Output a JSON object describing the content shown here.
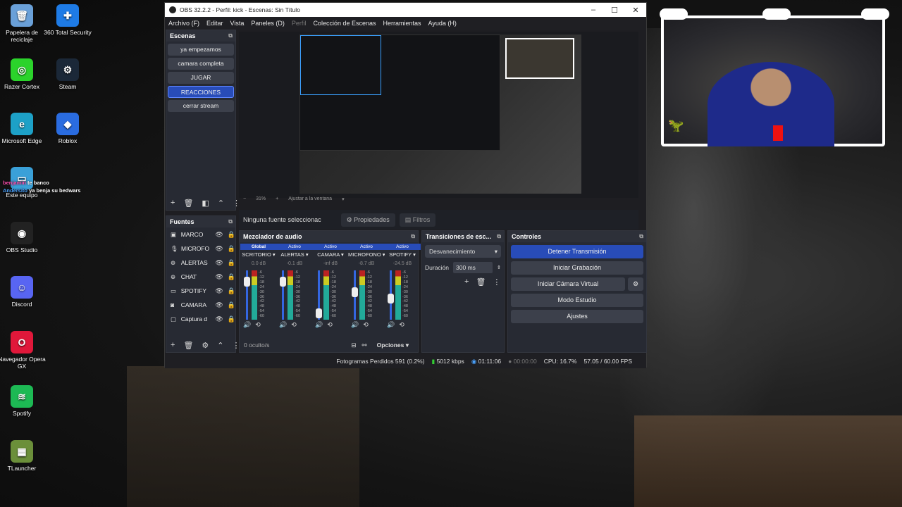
{
  "desktop": {
    "icons": [
      {
        "label": "Papelera de reciclaje",
        "icon": "recycle-bin-icon",
        "color": "#6aa0d8"
      },
      {
        "label": "360 Total Security",
        "icon": "shield-plus-icon",
        "color": "#1e7be6"
      },
      {
        "label": "Razer Cortex",
        "icon": "razer-icon",
        "color": "#2bd32b"
      },
      {
        "label": "Steam",
        "icon": "steam-icon",
        "color": "#1b2838"
      },
      {
        "label": "Microsoft Edge",
        "icon": "edge-icon",
        "color": "#1da1c7"
      },
      {
        "label": "Roblox",
        "icon": "roblox-icon",
        "color": "#2a6ce0"
      },
      {
        "label": "Este equipo",
        "icon": "computer-icon",
        "color": "#3aa0d8"
      },
      {
        "label": "OBS Studio",
        "icon": "obs-icon",
        "color": "#222222"
      },
      {
        "label": "Discord",
        "icon": "discord-icon",
        "color": "#5865f2"
      },
      {
        "label": "Navegador Opera GX",
        "icon": "opera-icon",
        "color": "#e0183a"
      },
      {
        "label": "Spotify",
        "icon": "spotify-icon",
        "color": "#1db954"
      },
      {
        "label": "TLauncher",
        "icon": "grass-block-icon",
        "color": "#6b8f3a"
      }
    ],
    "chat_overlay": [
      {
        "user": "benjamin",
        "text": "te banco"
      },
      {
        "user": "Andersito",
        "text": "ya benja su bedwars"
      }
    ]
  },
  "obs": {
    "title": "OBS 32.2.2 - Perfil: kick - Escenas: Sin Título",
    "menu": [
      "Archivo (F)",
      "Editar",
      "Vista",
      "Paneles (D)",
      "Perfil",
      "Colección de Escenas",
      "Herramientas",
      "Ayuda (H)"
    ],
    "scenes_title": "Escenas",
    "scenes": [
      "ya empezamos",
      "camara completa",
      "JUGAR",
      "REACCIONES",
      "cerrar stream"
    ],
    "selected_scene": "REACCIONES",
    "sources_title": "Fuentes",
    "sources": [
      {
        "label": "MARCO",
        "icon": "image-icon"
      },
      {
        "label": "MICROFO",
        "icon": "mic-icon"
      },
      {
        "label": "ALERTAS",
        "icon": "globe-icon"
      },
      {
        "label": "CHAT",
        "icon": "globe-icon"
      },
      {
        "label": "SPOTIFY",
        "icon": "window-icon"
      },
      {
        "label": "CAMARA",
        "icon": "camera-icon"
      },
      {
        "label": "Captura d",
        "icon": "monitor-icon"
      }
    ],
    "zoom": "31%",
    "fit_label": "Ajustar a la ventana",
    "no_source": "Ninguna fuente seleccionac",
    "properties": "Propiedades",
    "filters": "Filtros",
    "mixer_title": "Mezclador de audio",
    "channels": [
      {
        "status": "Global",
        "name": "SCRITORIO",
        "db": "0.0 dB",
        "level": 0.85
      },
      {
        "status": "Activo",
        "name": "ALERTAS",
        "db": "-0.1 dB",
        "level": 0.85
      },
      {
        "status": "Activo",
        "name": "CAMARA",
        "db": "-inf dB",
        "level": 0.1
      },
      {
        "status": "Activo",
        "name": "MICROFONO",
        "db": "-8.7 dB",
        "level": 0.6
      },
      {
        "status": "Activo",
        "name": "SPOTIFY",
        "db": "-24.5 dB",
        "level": 0.45
      }
    ],
    "meter_scale": [
      "-6",
      "-12",
      "-18",
      "-24",
      "-30",
      "-36",
      "-42",
      "-48",
      "-54",
      "-60"
    ],
    "hidden_count": "0 oculto/s",
    "options": "Opciones",
    "transitions_title": "Transiciones de esc...",
    "transition": "Desvanecimiento",
    "duration_label": "Duración",
    "duration_value": "300 ms",
    "controls_title": "Controles",
    "controls": {
      "stop_stream": "Detener Transmisión",
      "start_rec": "Iniciar Grabación",
      "virtual_cam": "Iniciar Cámara Virtual",
      "studio_mode": "Modo Estudio",
      "settings": "Ajustes"
    },
    "status": {
      "dropped": "Fotogramas Perdidos 591 (0.2%)",
      "bitrate": "5012 kbps",
      "live_time": "01:11:06",
      "rec_time": "00:00:00",
      "cpu": "CPU: 16.7%",
      "fps": "57.05 / 60.00 FPS"
    },
    "accent": "#284cb8"
  }
}
